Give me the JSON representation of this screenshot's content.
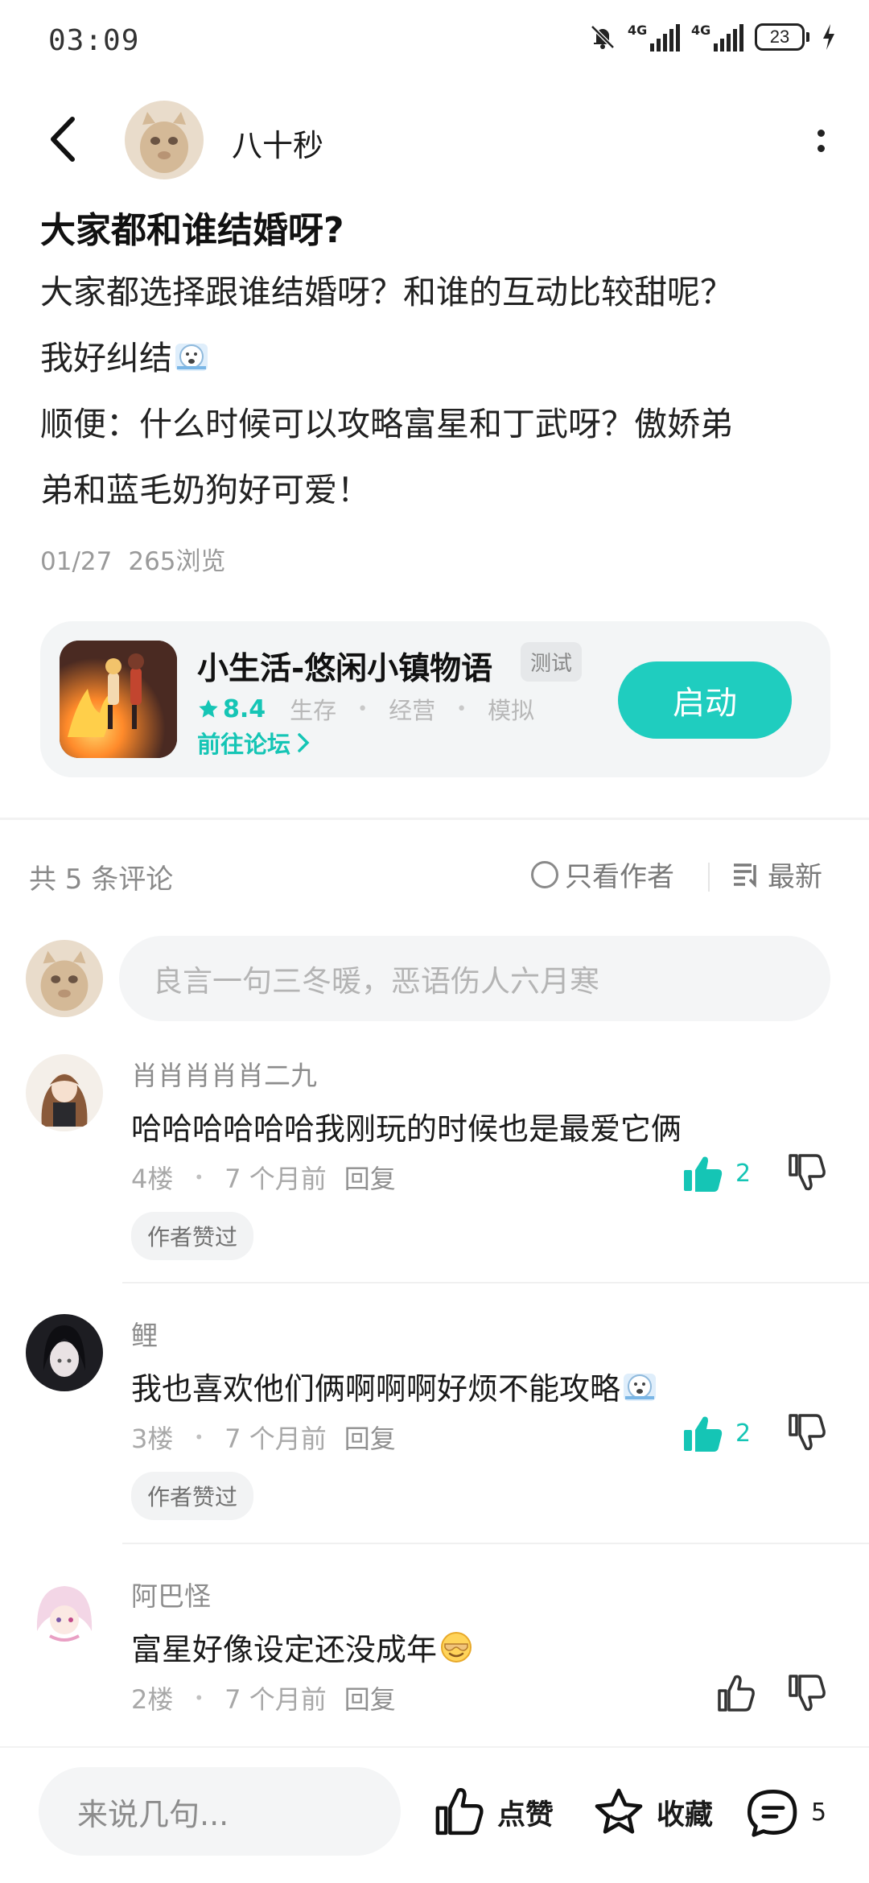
{
  "status_bar": {
    "time": "03:09",
    "signal1_label": "4G",
    "signal2_label": "4G",
    "battery": "23"
  },
  "header": {
    "author_name": "八十秒"
  },
  "post": {
    "title": "大家都和谁结婚呀?",
    "body_lines": [
      "大家都选择跟谁结婚呀？和谁的互动比较甜呢？",
      "我好纠结",
      "顺便：什么时候可以攻略富星和丁武呀？傲娇弟",
      "弟和蓝毛奶狗好可爱！"
    ],
    "date": "01/27",
    "views": "265浏览"
  },
  "game": {
    "name": "小生活-悠闲小镇物语",
    "tag": "测试",
    "rating": "8.4",
    "genres": [
      "生存",
      "经营",
      "模拟"
    ],
    "forum_link": "前往论坛",
    "launch_label": "启动"
  },
  "comments_header": {
    "count_text": "共 5 条评论",
    "only_author": "只看作者",
    "sort": "最新"
  },
  "comment_input": {
    "placeholder": "良言一句三冬暖，恶语伤人六月寒"
  },
  "comments": [
    {
      "user": "肖肖肖肖肖二九",
      "text": "哈哈哈哈哈哈我刚玩的时候也是最爱它俩",
      "floor": "4楼",
      "time": "7 个月前",
      "reply": "回复",
      "likes": "2",
      "badge": "作者赞过"
    },
    {
      "user": "鲤",
      "text": "我也喜欢他们俩啊啊啊好烦不能攻略",
      "floor": "3楼",
      "time": "7 个月前",
      "reply": "回复",
      "likes": "2",
      "badge": "作者赞过"
    },
    {
      "user": "阿巴怪",
      "text": "富星好像设定还没成年",
      "floor": "2楼",
      "time": "7 个月前",
      "reply": "回复"
    }
  ],
  "bottom_bar": {
    "input_placeholder": "来说几句...",
    "like_label": "点赞",
    "favorite_label": "收藏",
    "comment_count": "5"
  },
  "colors": {
    "accent": "#1fcdbf",
    "accent_text": "#15c5b5"
  }
}
